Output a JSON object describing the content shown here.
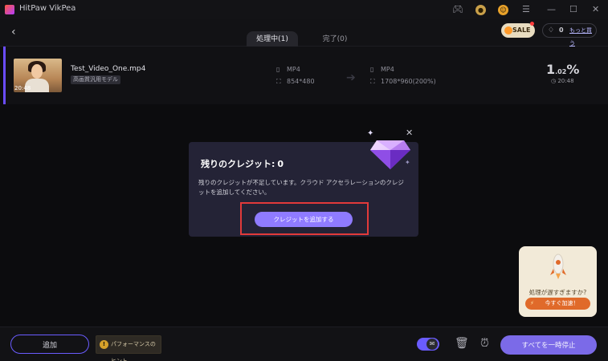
{
  "app": {
    "title": "HitPaw VikPea"
  },
  "titlebar": {
    "icons": [
      "gamepad-icon",
      "coin-icon",
      "user-icon",
      "menu-icon",
      "minimize-icon",
      "maximize-icon",
      "close-icon"
    ]
  },
  "header": {
    "tabs": [
      {
        "label": "処理中(1)",
        "active": true
      },
      {
        "label": "完了(0)",
        "active": false
      }
    ],
    "sale_label": "SALE",
    "credits_count": "0",
    "more_label": "もっと買う"
  },
  "task": {
    "filename": "Test_Video_One.mp4",
    "thumb_time": "20:48",
    "model_tag": "高画質汎用モデル",
    "source": {
      "format": "MP4",
      "resolution": "854*480"
    },
    "target": {
      "format": "MP4",
      "resolution": "1708*960(200%)"
    },
    "progress_main": "1",
    "progress_decimal": ".02",
    "progress_unit": "%",
    "time_left": "20:48"
  },
  "dialog": {
    "title": "残りのクレジット:",
    "credits": "0",
    "message": "残りのクレジットが不足しています。クラウド アクセラレーションのクレジットを追加してください。",
    "button_label": "クレジットを追加する"
  },
  "promo": {
    "question": "処理が遅すぎますか?",
    "button_label": "今すぐ加速！"
  },
  "footer": {
    "add_label": "追加",
    "hint_label": "パフォーマンスのヒント",
    "pause_all_label": "すべてを一時停止"
  },
  "colors": {
    "accent": "#6a5cff",
    "dialog_button": "#8f7bff",
    "highlight": "#e23a3a",
    "promo_button": "#e06a2a"
  }
}
